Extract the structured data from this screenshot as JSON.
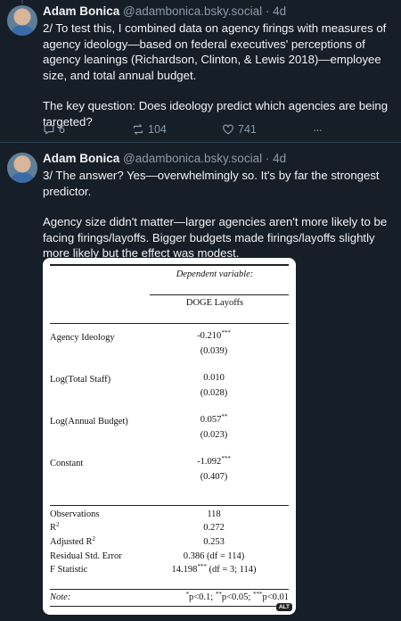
{
  "post1": {
    "author_name": "Adam Bonica",
    "author_handle": "@adambonica.bsky.social",
    "separator": "·",
    "time": "4d",
    "paragraphs": [
      "2/ To test this, I combined data on agency firings with measures of agency ideology—based on federal executives' perceptions of agency leanings (Richardson, Clinton, & Lewis 2018)—employee size, and total annual budget.",
      "The key question: Does ideology predict which agencies are being targeted?"
    ],
    "reply_count": "6",
    "repost_count": "104",
    "like_count": "741",
    "more_label": "···",
    "icons": [
      "reply-icon",
      "repost-icon",
      "like-icon",
      "more-icon"
    ]
  },
  "post2": {
    "author_name": "Adam Bonica",
    "author_handle": "@adambonica.bsky.social",
    "separator": "·",
    "time": "4d",
    "paragraphs": [
      "3/ The answer? Yes—overwhelmingly so. It's by far the strongest predictor.",
      "Agency size didn't matter—larger agencies aren't more likely to be facing firings/layoffs. Bigger budgets made firings/layoffs slightly more likely but the effect was modest."
    ],
    "alt_badge": "ALT"
  },
  "table": {
    "dep_var_label": "Dependent variable:",
    "dep_var": "DOGE Layoffs",
    "rows": [
      {
        "label": "Agency Ideology",
        "coef": "-0.210",
        "stars": "***",
        "se": "(0.039)"
      },
      {
        "label": "Log(Total Staff)",
        "coef": "0.010",
        "stars": "",
        "se": "(0.028)"
      },
      {
        "label": "Log(Annual Budget)",
        "coef": "0.057",
        "stars": "**",
        "se": "(0.023)"
      },
      {
        "label": "Constant",
        "coef": "-1.092",
        "stars": "***",
        "se": "(0.407)"
      }
    ],
    "stats": [
      {
        "label": "Observations",
        "value": "118"
      },
      {
        "label": "R",
        "label_sup": "2",
        "value": "0.272"
      },
      {
        "label": "Adjusted R",
        "label_sup": "2",
        "value": "0.253"
      },
      {
        "label": "Residual Std. Error",
        "value": "0.386 (df = 114)"
      },
      {
        "label": "F Statistic",
        "value": "14.198",
        "value_sup": "***",
        "value_tail": " (df = 3; 114)"
      }
    ],
    "note_label": "Note:",
    "note_parts": [
      {
        "sup": "*",
        "text": "p<0.1; "
      },
      {
        "sup": "**",
        "text": "p<0.05; "
      },
      {
        "sup": "***",
        "text": "p<0.01"
      }
    ]
  }
}
